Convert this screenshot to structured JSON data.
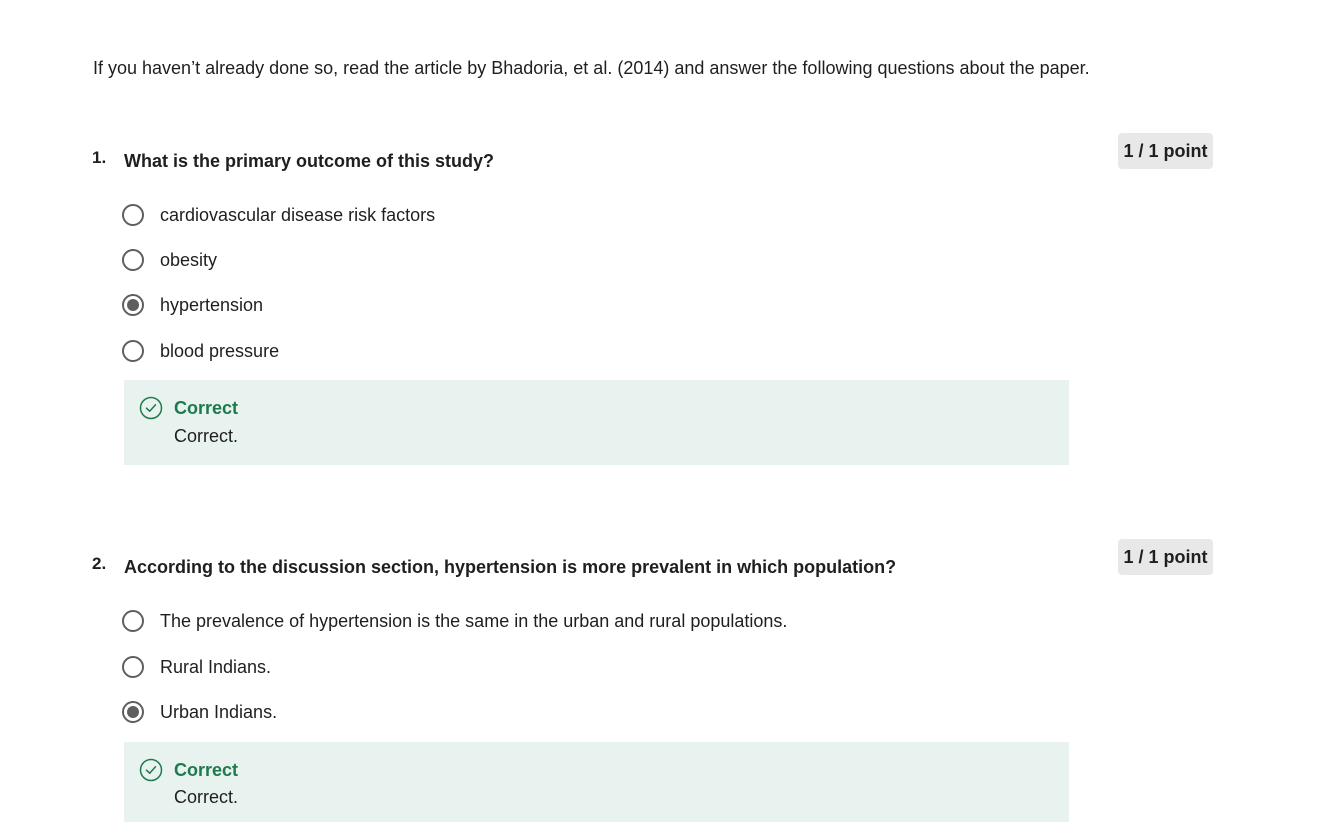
{
  "intro": "If you haven’t already done so, read the article by Bhadoria, et al. (2014) and answer the following questions about the paper.",
  "questions": [
    {
      "number": "1.",
      "text": "What is the primary outcome of this study?",
      "points": "1 / 1 point",
      "options": [
        {
          "label": "cardiovascular disease risk factors",
          "selected": false
        },
        {
          "label": "obesity",
          "selected": false
        },
        {
          "label": "hypertension",
          "selected": true
        },
        {
          "label": "blood pressure",
          "selected": false
        }
      ],
      "feedback": {
        "title": "Correct",
        "text": "Correct."
      }
    },
    {
      "number": "2.",
      "text": "According to the discussion section, hypertension is more prevalent in which population?",
      "points": "1 / 1 point",
      "options": [
        {
          "label": "The prevalence of hypertension is the same in the urban and rural populations.",
          "selected": false
        },
        {
          "label": "Rural Indians.",
          "selected": false
        },
        {
          "label": "Urban Indians.",
          "selected": true
        }
      ],
      "feedback": {
        "title": "Correct",
        "text": "Correct."
      }
    }
  ],
  "colors": {
    "correct_green": "#1e7a4c",
    "feedback_bg": "#e8f2ee",
    "points_bg": "#e8e8e8",
    "radio_gray": "#5f5f5f"
  },
  "icons": {
    "feedback_icon": "check-circle-icon"
  }
}
